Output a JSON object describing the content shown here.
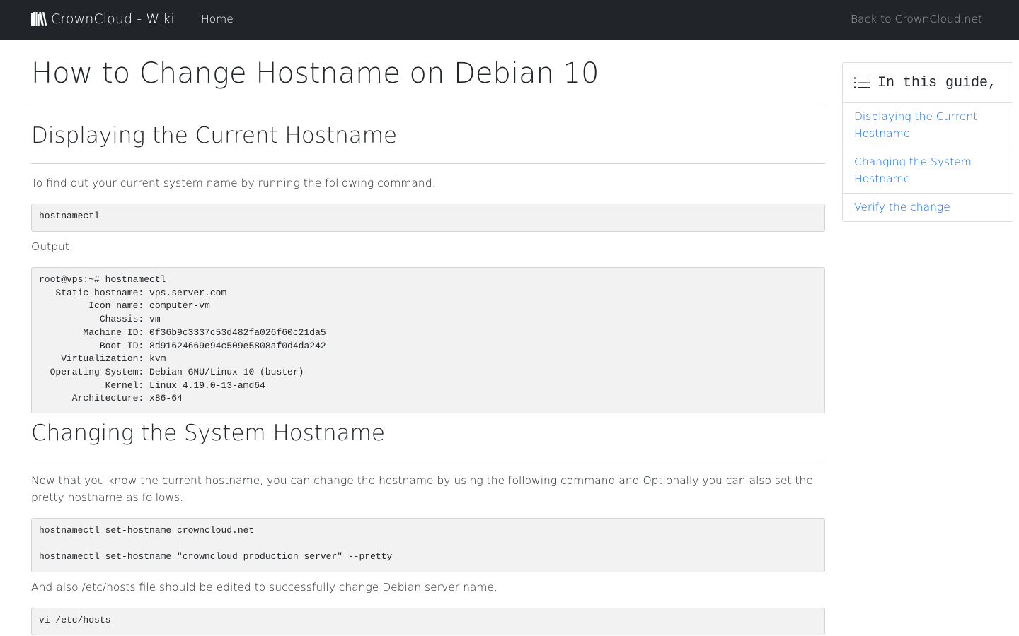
{
  "navbar": {
    "brand": "CrownCloud - Wiki",
    "brand_icon": "books-icon",
    "home": "Home",
    "back": "Back to CrownCloud.net"
  },
  "article": {
    "title": "How to Change Hostname on Debian 10",
    "sections": [
      {
        "heading": "Displaying the Current Hostname",
        "intro": "To find out your current system name by running the following command.",
        "command": "hostnamectl",
        "output_label": "Output:",
        "output": "root@vps:~# hostnamectl\n   Static hostname: vps.server.com\n         Icon name: computer-vm\n           Chassis: vm\n        Machine ID: 0f36b9c3337c53d482fa026f60c21da5\n           Boot ID: 8d91624669e94c509e5808af0d4da242\n    Virtualization: kvm\n  Operating System: Debian GNU/Linux 10 (buster)\n            Kernel: Linux 4.19.0-13-amd64\n      Architecture: x86-64"
      },
      {
        "heading": "Changing the System Hostname",
        "intro": "Now that you know the current hostname, you can change the hostname by using the following command and Optionally you can also set the pretty hostname as follows.",
        "command": "hostnamectl set-hostname crowncloud.net\n\nhostnamectl set-hostname \"crowncloud production server\" --pretty",
        "note": "And also /etc/hosts file should be edited to successfully change Debian server name.",
        "command2": "vi /etc/hosts"
      }
    ]
  },
  "toc": {
    "icon": "list-icon",
    "title": "In this guide,",
    "items": [
      "Displaying the Current Hostname",
      "Changing the System Hostname",
      "Verify the change"
    ]
  },
  "colors": {
    "navbar_bg": "#212529",
    "link": "#0d6efd",
    "code_bg": "#f2f2f2"
  }
}
